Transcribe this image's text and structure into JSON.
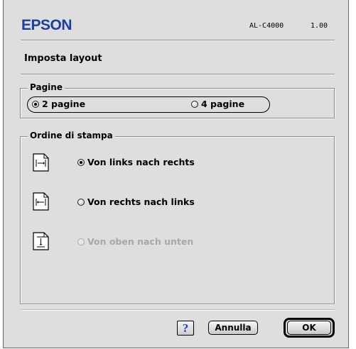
{
  "header": {
    "brand": "EPSON",
    "model": "AL-C4000",
    "version": "1.00"
  },
  "page": {
    "title": "Imposta layout"
  },
  "pages_group": {
    "label": "Pagine",
    "options": [
      {
        "label": "2 pagine",
        "checked": true
      },
      {
        "label": "4 pagine",
        "checked": false
      }
    ]
  },
  "order_group": {
    "label": "Ordine di stampa",
    "options": [
      {
        "label": "Von links nach rechts",
        "checked": true,
        "enabled": true,
        "icon": "left-to-right-arrow-icon"
      },
      {
        "label": "Von rechts nach links",
        "checked": false,
        "enabled": true,
        "icon": "right-to-left-arrow-icon"
      },
      {
        "label": "Von oben nach unten",
        "checked": false,
        "enabled": false,
        "icon": "top-to-bottom-arrow-icon"
      }
    ]
  },
  "buttons": {
    "help_label": "?",
    "cancel_label": "Annulla",
    "ok_label": "OK"
  },
  "colors": {
    "brand_blue": "#1a3fa0",
    "dialog_bg": "#dedede",
    "help_blue": "#1a3fd0",
    "disabled_text": "#a8a8a8"
  }
}
